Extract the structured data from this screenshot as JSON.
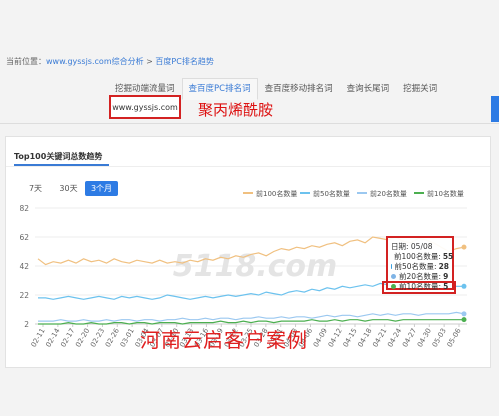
{
  "breadcrumb": {
    "prefix": "当前位置：",
    "site": "www.gyssjs.com综合分析",
    "sep": " > ",
    "current": "百度PC排名趋势"
  },
  "tabs": [
    "挖掘动端流量词",
    "查百度PC排名词",
    "查百度移动排名词",
    "查询长尾词",
    "挖掘关词"
  ],
  "active_tab": 1,
  "domain_input": {
    "value": "www.gyssjs.com"
  },
  "overlay_top": "聚丙烯酰胺",
  "card": {
    "title": "Top100关键词总数趋势"
  },
  "ranges": [
    "7天",
    "30天",
    "3个月"
  ],
  "active_range": 2,
  "watermark": "5118.com",
  "overlay_bottom": "河南云启客户案例",
  "colors": {
    "top100": "#f0c080",
    "top50": "#6cc2ee",
    "top20": "#9bc8f0",
    "top10": "#4caf50",
    "accent": "#2d7be4",
    "red": "#d32222"
  },
  "chart_data": {
    "type": "line",
    "title": "Top100关键词总数趋势",
    "yticks": [
      2,
      22,
      42,
      62,
      82
    ],
    "ylim": [
      2,
      82
    ],
    "xticks": [
      "02-11",
      "02-14",
      "02-17",
      "02-20",
      "02-23",
      "02-26",
      "03-01",
      "03-04",
      "03-07",
      "03-10",
      "03-13",
      "03-16",
      "03-19",
      "03-22",
      "03-25",
      "03-28",
      "03-31",
      "04-03",
      "04-06",
      "04-09",
      "04-12",
      "04-15",
      "04-18",
      "04-21",
      "04-24",
      "04-27",
      "04-30",
      "05-03",
      "05-06"
    ],
    "series": [
      {
        "name": "前100名数量",
        "color": "#f0c080",
        "values": [
          47,
          43,
          45,
          44,
          46,
          44,
          47,
          45,
          46,
          44,
          47,
          45,
          44,
          46,
          45,
          44,
          46,
          44,
          45,
          44,
          46,
          45,
          47,
          46,
          48,
          47,
          49,
          48,
          50,
          51,
          49,
          52,
          54,
          53,
          55,
          54,
          56,
          55,
          57,
          58,
          56,
          59,
          60,
          58,
          62,
          61,
          60,
          62,
          59,
          58,
          61,
          60,
          58,
          55,
          52,
          54,
          55
        ]
      },
      {
        "name": "前50名数量",
        "color": "#6cc2ee",
        "values": [
          20,
          20,
          19,
          20,
          21,
          20,
          19,
          20,
          21,
          20,
          19,
          21,
          20,
          21,
          20,
          19,
          20,
          22,
          21,
          20,
          19,
          20,
          21,
          20,
          21,
          22,
          21,
          22,
          23,
          22,
          24,
          23,
          22,
          24,
          25,
          24,
          26,
          25,
          27,
          26,
          28,
          27,
          28,
          29,
          28,
          30,
          29,
          28,
          29,
          30,
          29,
          28,
          29,
          28,
          29,
          28,
          28
        ]
      },
      {
        "name": "前20名数量",
        "color": "#9bc8f0",
        "values": [
          4,
          4,
          4,
          5,
          4,
          4,
          5,
          4,
          4,
          5,
          4,
          5,
          5,
          4,
          5,
          5,
          4,
          5,
          5,
          6,
          5,
          5,
          6,
          5,
          6,
          6,
          5,
          6,
          6,
          7,
          6,
          6,
          7,
          6,
          7,
          7,
          6,
          7,
          8,
          7,
          8,
          8,
          7,
          8,
          9,
          8,
          9,
          8,
          9,
          9,
          8,
          9,
          9,
          9,
          9,
          10,
          9
        ]
      },
      {
        "name": "前10名数量",
        "color": "#4caf50",
        "values": [
          2,
          2,
          2,
          2,
          3,
          2,
          2,
          3,
          2,
          2,
          3,
          3,
          2,
          3,
          3,
          2,
          3,
          3,
          3,
          2,
          3,
          3,
          3,
          3,
          4,
          3,
          3,
          4,
          3,
          4,
          4,
          3,
          4,
          4,
          4,
          4,
          5,
          4,
          4,
          5,
          4,
          5,
          5,
          4,
          5,
          5,
          5,
          4,
          5,
          5,
          5,
          5,
          5,
          5,
          5,
          5,
          5
        ]
      }
    ],
    "tooltip": {
      "date_label": "日期: 05/08",
      "rows": [
        {
          "label": "前100名数量:",
          "value": "55",
          "color": "#f0a030"
        },
        {
          "label": "前50名数量:",
          "value": "28",
          "color": "#3aa0e0"
        },
        {
          "label": "前20名数量:",
          "value": "9",
          "color": "#7fb4e6"
        },
        {
          "label": "前10名数量:",
          "value": "5",
          "color": "#4caf50"
        }
      ]
    }
  }
}
